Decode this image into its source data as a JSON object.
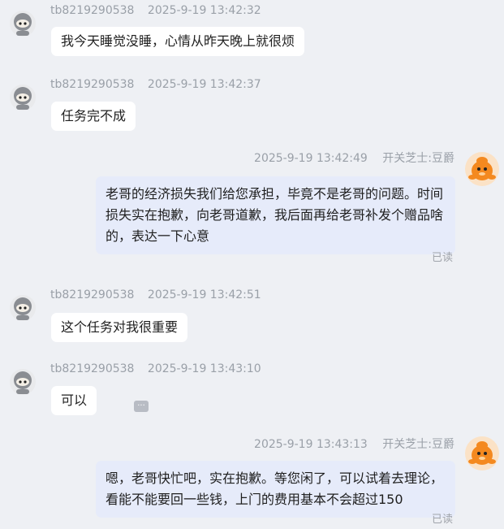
{
  "messages": [
    {
      "sender": "tb8219290538",
      "time": "2025-9-19 13:42:32",
      "text": "我今天睡觉没睡，心情从昨天晚上就很烦"
    },
    {
      "sender": "tb8219290538",
      "time": "2025-9-19 13:42:37",
      "text": "任务完不成"
    },
    {
      "sender": "开关芝士:豆爵",
      "time": "2025-9-19 13:42:49",
      "text": "老哥的经济损失我们给您承担，毕竟不是老哥的问题。时间损失实在抱歉，向老哥道歉，我后面再给老哥补发个赠品啥的，表达一下心意",
      "status": "已读"
    },
    {
      "sender": "tb8219290538",
      "time": "2025-9-19 13:42:51",
      "text": "这个任务对我很重要"
    },
    {
      "sender": "tb8219290538",
      "time": "2025-9-19 13:43:10",
      "text": "可以",
      "more": "···"
    },
    {
      "sender": "开关芝士:豆爵",
      "time": "2025-9-19 13:43:13",
      "text": "嗯，老哥快忙吧，实在抱歉。等您闲了，可以试着去理论，看能不能要回一些钱，上门的费用基本不会超过150",
      "status": "已读"
    }
  ],
  "colors": {
    "background": "#eef0f4",
    "incoming_bubble": "#ffffff",
    "outgoing_bubble": "#e6ebfa",
    "meta_text": "#9aa0a8"
  },
  "icons": {
    "customer_avatar": "grey-ninja-avatar-icon",
    "agent_avatar": "orange-mascot-avatar-icon",
    "more": "ellipsis-icon"
  }
}
